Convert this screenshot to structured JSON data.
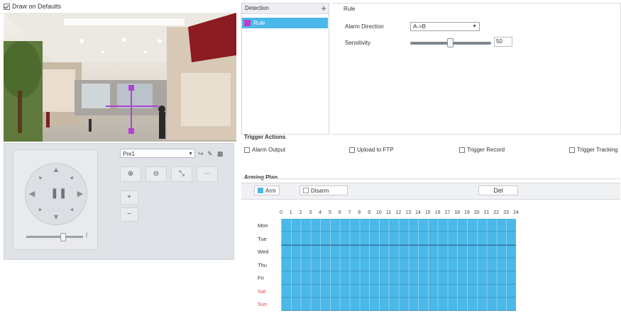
{
  "camera": {
    "header_label": "Draw on Defaults"
  },
  "ptz": {
    "preset_value": "Pre1",
    "icons": [
      "up-arrow",
      "down-arrow",
      "left-arrow",
      "right-arrow",
      "up-left-arrow",
      "up-right-arrow",
      "down-left-arrow",
      "down-right-arrow",
      "pause",
      "zoom-in",
      "zoom-out",
      "focus-near",
      "focus-far",
      "plus",
      "minus"
    ]
  },
  "rules": {
    "list_title": "Detection",
    "items": [
      {
        "label": "Rule",
        "color": "#c03cc8"
      }
    ]
  },
  "params": {
    "rule_heading": "Rule",
    "alarm_direction_label": "Alarm Direction",
    "alarm_direction_value": "A->B",
    "sensitivity_label": "Sensitivity",
    "sensitivity_value": "50"
  },
  "trigger_actions": {
    "title": "Trigger Actions",
    "items": [
      "Alarm Output",
      "Upload to FTP",
      "Trigger Record",
      "Trigger Tracking"
    ]
  },
  "schedule": {
    "title": "Arming Plan",
    "draw_label": "Arm",
    "erase_label": "Disarm",
    "delete_label": "Del",
    "hours": [
      "0",
      "1",
      "2",
      "3",
      "4",
      "5",
      "6",
      "7",
      "8",
      "9",
      "10",
      "11",
      "12",
      "13",
      "14",
      "15",
      "16",
      "17",
      "18",
      "19",
      "20",
      "21",
      "22",
      "23",
      "24"
    ],
    "days": [
      "Mon",
      "Tue",
      "Wed",
      "Thu",
      "Fri",
      "Sat",
      "Sun"
    ],
    "colors": {
      "armed": "#4ab8e8",
      "weekend": "#e0464d"
    }
  }
}
